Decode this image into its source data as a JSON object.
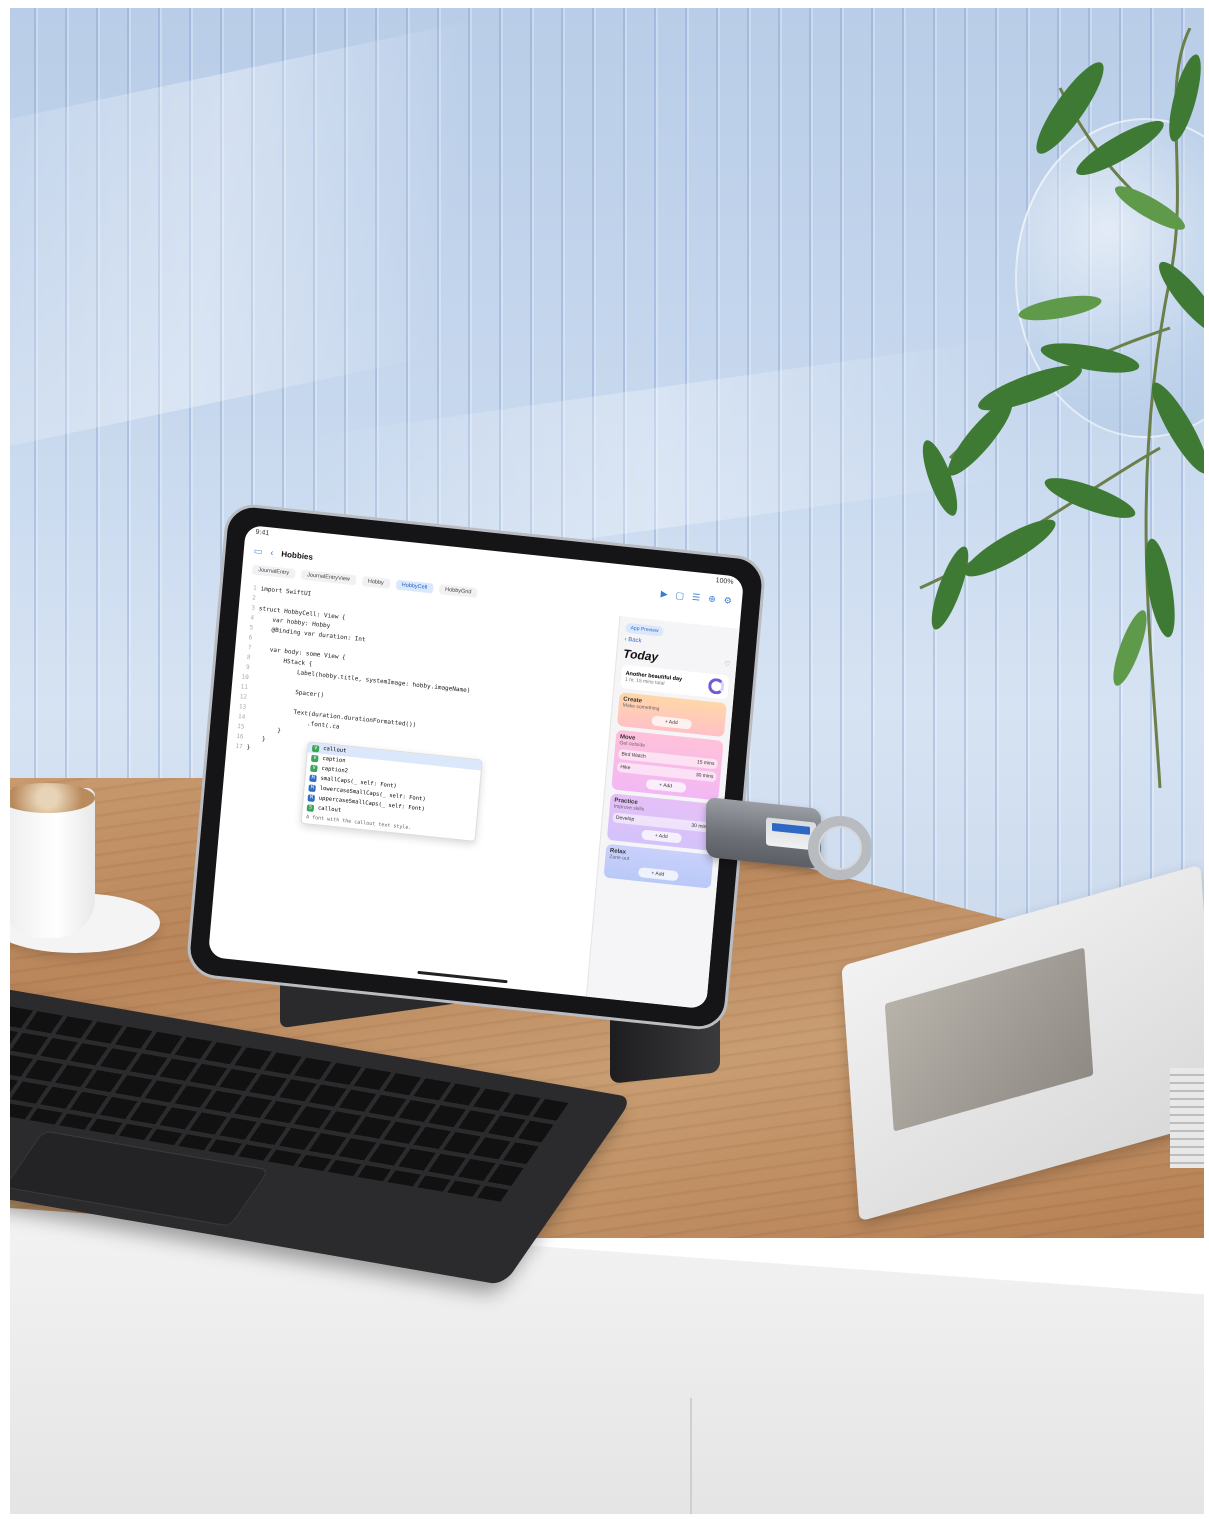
{
  "ipad": {
    "status": {
      "time": "9:41",
      "battery": "100%"
    },
    "toolbar": {
      "title": "Hobbies"
    },
    "tabs": [
      {
        "label": "JournalEntry",
        "active": false
      },
      {
        "label": "JournalEntryView",
        "active": false
      },
      {
        "label": "Hobby",
        "active": false
      },
      {
        "label": "HobbyCell",
        "active": true
      },
      {
        "label": "HobbyGrid",
        "active": false
      }
    ],
    "editor": {
      "lines": [
        "import SwiftUI",
        "",
        "struct HobbyCell: View {",
        "    var hobby: Hobby",
        "    @Binding var duration: Int",
        "",
        "    var body: some View {",
        "        HStack {",
        "            Label(hobby.title, systemImage: hobby.imageName)",
        "",
        "            Spacer()",
        "",
        "            Text(duration.durationFormatted())",
        "                .font(.ca",
        "        }",
        "    }",
        "}"
      ],
      "line_numbers": [
        "1",
        "2",
        "3",
        "4",
        "5",
        "6",
        "7",
        "8",
        "9",
        "10",
        "11",
        "12",
        "13",
        "14",
        "15",
        "16",
        "17"
      ],
      "autocomplete": {
        "items": [
          {
            "badge": "V",
            "kind": "value",
            "label": "callout",
            "selected": true
          },
          {
            "badge": "V",
            "kind": "value",
            "label": "caption",
            "selected": false
          },
          {
            "badge": "V",
            "kind": "value",
            "label": "caption2",
            "selected": false
          },
          {
            "badge": "M",
            "kind": "method",
            "label": "smallCaps(_ self: Font)",
            "selected": false
          },
          {
            "badge": "M",
            "kind": "method",
            "label": "lowercaseSmallCaps(_ self: Font)",
            "selected": false
          },
          {
            "badge": "M",
            "kind": "method",
            "label": "uppercaseSmallCaps(_ self: Font)",
            "selected": false
          },
          {
            "badge": "S",
            "kind": "value",
            "label": "callout",
            "selected": false
          }
        ],
        "description": "A font with the callout text style."
      }
    },
    "preview": {
      "tag": "App Preview",
      "back": "Back",
      "title": "Today",
      "summary": {
        "headline": "Another beautiful day",
        "detail": "1 hr, 15 mins total"
      },
      "cards": [
        {
          "key": "create",
          "title": "Create",
          "subtitle": "Make something",
          "rows": [],
          "add": "+ Add"
        },
        {
          "key": "move",
          "title": "Move",
          "subtitle": "Get outside",
          "rows": [
            {
              "name": "Bird Watch",
              "value": "15 mins"
            },
            {
              "name": "Hike",
              "value": "30 mins"
            }
          ],
          "add": "+ Add"
        },
        {
          "key": "practice",
          "title": "Practice",
          "subtitle": "Improve skills",
          "rows": [
            {
              "name": "Develop",
              "value": "30 mins"
            }
          ],
          "add": "+ Add"
        },
        {
          "key": "relax",
          "title": "Relax",
          "subtitle": "Zone out",
          "rows": [],
          "add": "+ Add"
        }
      ]
    }
  },
  "colors": {
    "wall": "#c7d8ee",
    "desk": "#c89a6e",
    "accent": "#2e6cc7",
    "usb_tongue": "#2d68c4"
  },
  "icons": [
    "sidebar-icon",
    "back-chevron-icon",
    "play-icon",
    "device-icon",
    "list-icon",
    "plus-icon",
    "settings-icon",
    "heart-icon",
    "walk-icon",
    "binoculars-icon",
    "hike-icon",
    "paint-icon",
    "graduation-icon",
    "sofa-icon"
  ]
}
